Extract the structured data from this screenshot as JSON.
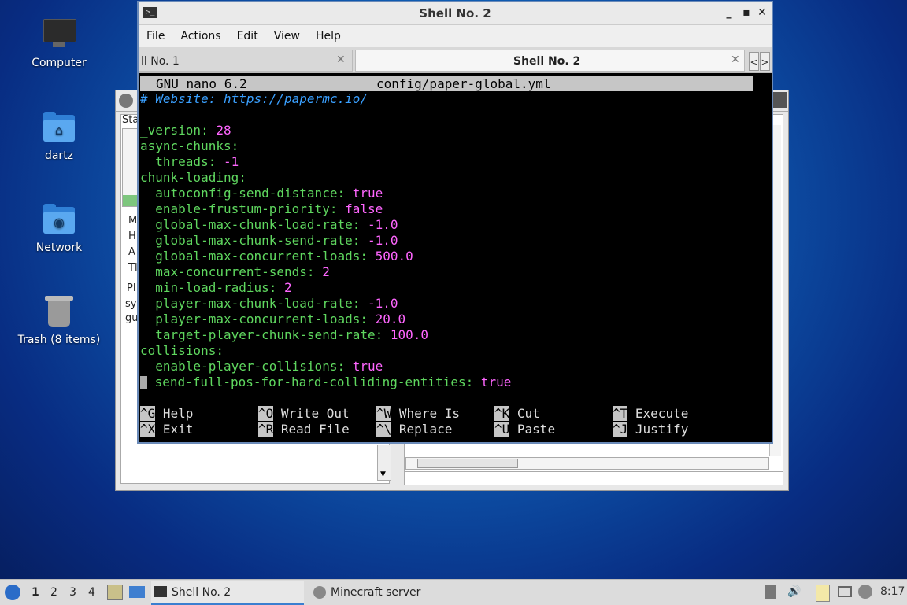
{
  "desktop": {
    "icons": [
      {
        "label": "Computer"
      },
      {
        "label": "dartz"
      },
      {
        "label": "Network"
      },
      {
        "label": "Trash (8 items)"
      }
    ]
  },
  "background_window": {
    "labels": [
      "Sta",
      "M",
      "H",
      "A",
      "Tl",
      "Pl",
      "sy",
      "gu"
    ]
  },
  "terminal": {
    "title": "Shell No. 2",
    "title_icon": ">_",
    "window_buttons": [
      "_",
      "▪",
      "✕"
    ],
    "menu": [
      "File",
      "Actions",
      "Edit",
      "View",
      "Help"
    ],
    "tabs": [
      {
        "label": "ll No. 1",
        "close": "✕"
      },
      {
        "label": "Shell No. 2",
        "close": "✕"
      }
    ],
    "tab_nav": [
      "<",
      ">"
    ]
  },
  "nano": {
    "app": "GNU nano 6.2",
    "file": "config/paper-global.yml",
    "lines": [
      {
        "type": "comment",
        "text": "# Website: https://papermc.io/"
      },
      {
        "type": "blank",
        "text": ""
      },
      {
        "type": "kv",
        "key": "_version: ",
        "value": "28"
      },
      {
        "type": "kv",
        "key": "async-chunks:",
        "value": ""
      },
      {
        "type": "kv",
        "key": "  threads: ",
        "value": "-1"
      },
      {
        "type": "kv",
        "key": "chunk-loading:",
        "value": ""
      },
      {
        "type": "kv",
        "key": "  autoconfig-send-distance: ",
        "value": "true"
      },
      {
        "type": "kv",
        "key": "  enable-frustum-priority: ",
        "value": "false"
      },
      {
        "type": "kv",
        "key": "  global-max-chunk-load-rate: ",
        "value": "-1.0"
      },
      {
        "type": "kv",
        "key": "  global-max-chunk-send-rate: ",
        "value": "-1.0"
      },
      {
        "type": "kv",
        "key": "  global-max-concurrent-loads: ",
        "value": "500.0"
      },
      {
        "type": "kv",
        "key": "  max-concurrent-sends: ",
        "value": "2"
      },
      {
        "type": "kv",
        "key": "  min-load-radius: ",
        "value": "2"
      },
      {
        "type": "kv",
        "key": "  player-max-chunk-load-rate: ",
        "value": "-1.0"
      },
      {
        "type": "kv",
        "key": "  player-max-concurrent-loads: ",
        "value": "20.0"
      },
      {
        "type": "kv",
        "key": "  target-player-chunk-send-rate: ",
        "value": "100.0"
      },
      {
        "type": "kv",
        "key": "collisions:",
        "value": ""
      },
      {
        "type": "kv",
        "key": "  enable-player-collisions: ",
        "value": "true"
      },
      {
        "type": "kv",
        "key": " send-full-pos-for-hard-colliding-entities: ",
        "value": "true"
      }
    ],
    "shortcuts": [
      {
        "key": "^G",
        "label": "Help"
      },
      {
        "key": "^O",
        "label": "Write Out"
      },
      {
        "key": "^W",
        "label": "Where Is"
      },
      {
        "key": "^K",
        "label": "Cut"
      },
      {
        "key": "^T",
        "label": "Execute"
      },
      {
        "key": "^X",
        "label": "Exit"
      },
      {
        "key": "^R",
        "label": "Read File"
      },
      {
        "key": "^\\",
        "label": "Replace"
      },
      {
        "key": "^U",
        "label": "Paste"
      },
      {
        "key": "^J",
        "label": "Justify"
      }
    ]
  },
  "taskbar": {
    "workspaces": [
      "1",
      "2",
      "3",
      "4"
    ],
    "tasks": [
      {
        "label": "Shell No. 2"
      },
      {
        "label": "Minecraft server"
      }
    ],
    "clock": "8:17"
  },
  "colors": {
    "key": "#5fd75f",
    "value": "#ff66ff",
    "comment": "#3aa0ff",
    "titlebar_border": "#6a8ab8"
  }
}
